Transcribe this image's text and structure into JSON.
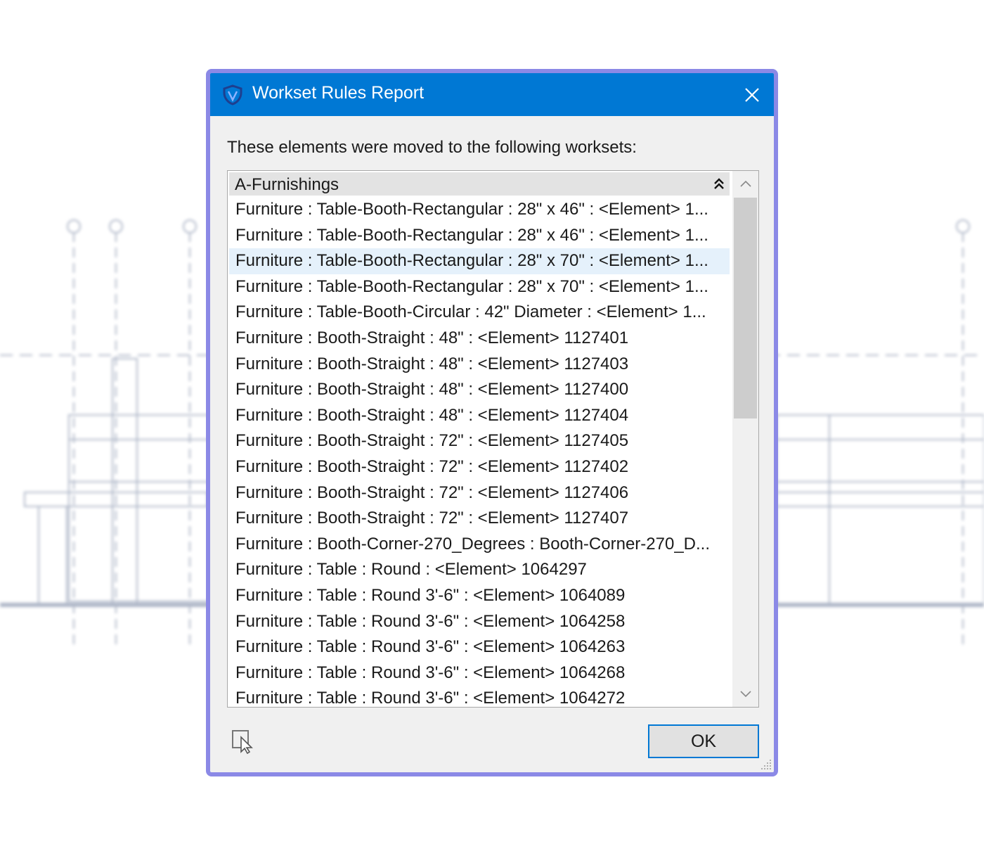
{
  "window": {
    "title": "Workset Rules Report",
    "message": "These elements were moved to the following worksets:"
  },
  "group": {
    "name": "A-Furnishings",
    "collapse_icon": "collapse-double-chevron-icon"
  },
  "rows": [
    "Furniture : Table-Booth-Rectangular : 28\" x 46\" : <Element> 1...",
    "Furniture : Table-Booth-Rectangular : 28\" x 46\" : <Element> 1...",
    "Furniture : Table-Booth-Rectangular : 28\" x 70\" : <Element> 1...",
    "Furniture : Table-Booth-Rectangular : 28\" x 70\" : <Element> 1...",
    "Furniture : Table-Booth-Circular : 42\" Diameter : <Element> 1...",
    "Furniture : Booth-Straight : 48\" : <Element> 1127401",
    "Furniture : Booth-Straight : 48\" : <Element> 1127403",
    "Furniture : Booth-Straight : 48\" : <Element> 1127400",
    "Furniture : Booth-Straight : 48\" : <Element> 1127404",
    "Furniture : Booth-Straight : 72\" : <Element> 1127405",
    "Furniture : Booth-Straight : 72\" : <Element> 1127402",
    "Furniture : Booth-Straight : 72\" : <Element> 1127406",
    "Furniture : Booth-Straight : 72\" : <Element> 1127407",
    "Furniture : Booth-Corner-270_Degrees : Booth-Corner-270_D...",
    "Furniture : Table : Round : <Element> 1064297",
    "Furniture : Table : Round 3'-6\" : <Element> 1064089",
    "Furniture : Table : Round 3'-6\" : <Element> 1064258",
    "Furniture : Table : Round 3'-6\" : <Element> 1064263",
    "Furniture : Table : Round 3'-6\" : <Element> 1064268",
    "Furniture : Table : Round 3'-6\" : <Element> 1064272"
  ],
  "selected_row_index": 2,
  "buttons": {
    "ok": "OK"
  },
  "colors": {
    "titlebar": "#0078d4",
    "dialog_border": "#8b89e6",
    "selection": "#e5f1fb"
  }
}
